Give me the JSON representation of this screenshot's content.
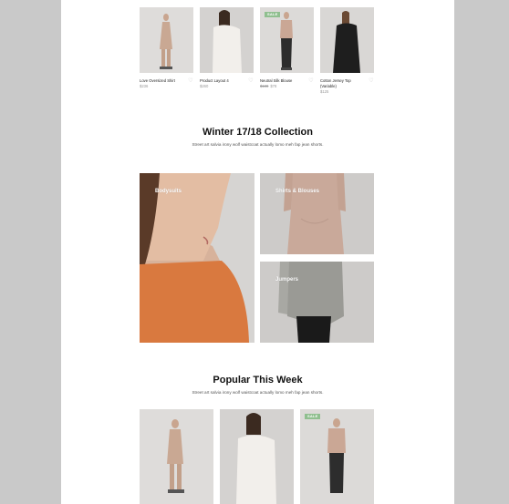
{
  "top_products": [
    {
      "name": "Love Oversized Shirt",
      "price": "$236",
      "old_price": "",
      "sale_badge": "",
      "heart_icon": "heart-icon"
    },
    {
      "name": "Product Layout 4",
      "price": "$260",
      "old_price": "",
      "sale_badge": "",
      "heart_icon": "heart-icon"
    },
    {
      "name": "Neutral Silk Blouse",
      "price": "$78",
      "old_price": "$188",
      "sale_badge": "SALE",
      "heart_icon": "heart-icon"
    },
    {
      "name": "Cotton Jersey Top",
      "name_line2": "(Variable)",
      "price": "$125",
      "old_price": "",
      "sale_badge": "",
      "heart_icon": "heart-icon"
    }
  ],
  "collection": {
    "title": "Winter 17/18 Collection",
    "subtitle": "Street art salvia irony wolf waistcoat actually lomo meh fap jean shorts.",
    "categories": [
      {
        "label": "Bodysuits"
      },
      {
        "label": "Shirts & Blouses"
      },
      {
        "label": "Jumpers"
      }
    ]
  },
  "popular": {
    "title": "Popular This Week",
    "subtitle": "Street art salvia irony wolf waistcoat actually lomo meh fap jean shorts.",
    "products": [
      {
        "sale_badge": ""
      },
      {
        "sale_badge": ""
      },
      {
        "sale_badge": "SALE"
      }
    ]
  },
  "colors": {
    "sale_badge": "#8fbf8f",
    "page_bg": "#ffffff",
    "frame_bg": "#c9c9c9",
    "orange_top": "#d9793f"
  }
}
